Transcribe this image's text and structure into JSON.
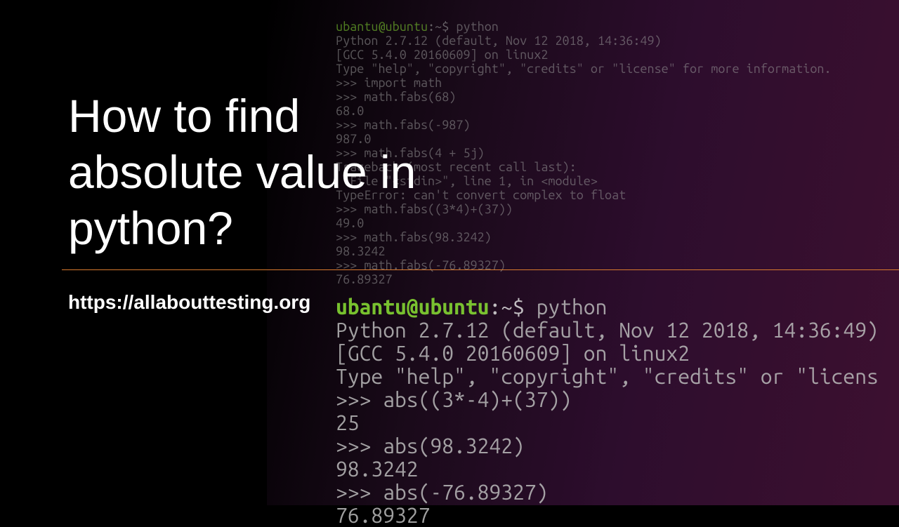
{
  "title": "How to find absolute value in python?",
  "url": "https://allabouttesting.org",
  "terminal_small": {
    "prompt_user": "ubantu@ubuntu",
    "prompt_path": ":~$",
    "command": " python",
    "lines": [
      "Python 2.7.12 (default, Nov 12 2018, 14:36:49)",
      "[GCC 5.4.0 20160609] on linux2",
      "Type \"help\", \"copyright\", \"credits\" or \"license\" for more information.",
      ">>> import math",
      ">>> math.fabs(68)",
      "68.0",
      ">>> math.fabs(-987)",
      "987.0",
      ">>> math.fabs(4 + 5j)",
      "Traceback (most recent call last):",
      "  File \"<stdin>\", line 1, in <module>",
      "TypeError: can't convert complex to float",
      ">>> math.fabs((3*4)+(37))",
      "49.0",
      ">>> math.fabs(98.3242)",
      "98.3242",
      ">>> math.fabs(-76.89327)",
      "76.89327"
    ]
  },
  "terminal_large": {
    "prompt_user": "ubantu@ubuntu",
    "prompt_path": ":~$",
    "command": " python",
    "lines": [
      "Python 2.7.12 (default, Nov 12 2018, 14:36:49)",
      "[GCC 5.4.0 20160609] on linux2",
      "Type \"help\", \"copyright\", \"credits\" or \"licens",
      ">>> abs((3*-4)+(37))",
      "25",
      ">>> abs(98.3242)",
      "98.3242",
      ">>> abs(-76.89327)",
      "76.89327"
    ]
  }
}
